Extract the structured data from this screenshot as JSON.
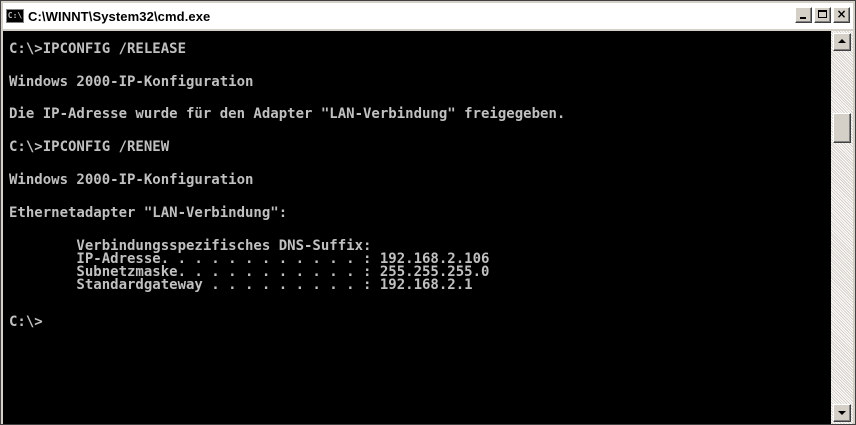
{
  "window": {
    "title": "C:\\WINNT\\System32\\cmd.exe",
    "icon_label": "C:\\",
    "controls": {
      "minimize": "minimize-icon",
      "maximize": "maximize-icon",
      "close": "close-icon",
      "close_glyph": "×"
    }
  },
  "console": {
    "lines": [
      "C:\\>IPCONFIG /RELEASE",
      "Windows 2000-IP-Konfiguration",
      "Die IP-Adresse wurde für den Adapter \"LAN-Verbindung\" freigegeben.",
      "C:\\>IPCONFIG /RENEW",
      "Windows 2000-IP-Konfiguration",
      "Ethernetadapter \"LAN-Verbindung\":",
      "        Verbindungsspezifisches DNS-Suffix:",
      "        IP-Adresse. . . . . . . . . . . . : 192.168.2.106",
      "        Subnetzmaske. . . . . . . . . . . : 255.255.255.0",
      "        Standardgateway . . . . . . . . . : 192.168.2.1",
      "C:\\>"
    ]
  },
  "colors": {
    "console_background": "#000000",
    "console_text": "#c0c0c0",
    "title_bar": "#ffffff",
    "chrome": "#d4d0c8"
  }
}
